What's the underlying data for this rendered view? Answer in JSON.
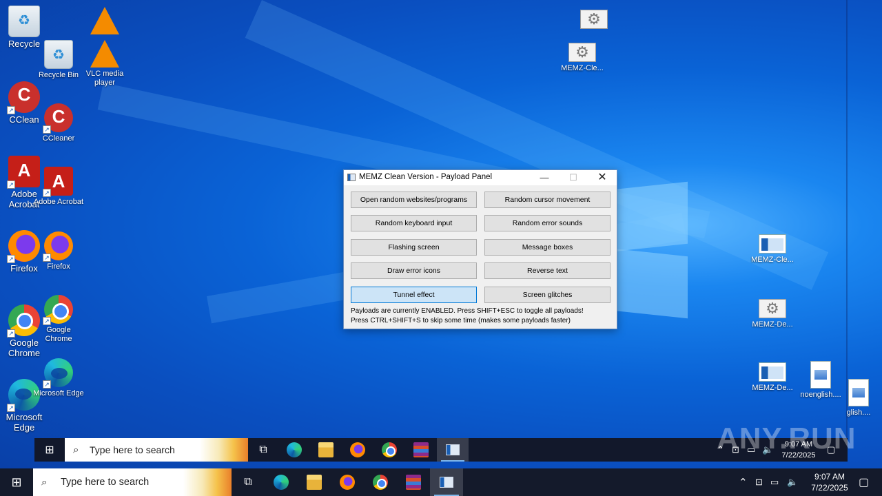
{
  "desktop_icons_outer": [
    {
      "id": "recycle",
      "label": "Recycle",
      "icon": "recycle-bin-icon"
    },
    {
      "id": "ccleaner",
      "label": "CClean",
      "icon": "ccleaner-icon"
    },
    {
      "id": "acrobat",
      "label": "Adobe Acrobat",
      "icon": "adobe-acrobat-icon"
    },
    {
      "id": "firefox",
      "label": "Firefox",
      "icon": "firefox-icon"
    },
    {
      "id": "chrome",
      "label": "Google Chrome",
      "icon": "chrome-icon"
    },
    {
      "id": "edge",
      "label": "Microsoft Edge",
      "icon": "edge-icon"
    }
  ],
  "desktop_icons_nested": [
    {
      "id": "recycle",
      "label": "Recycle Bin",
      "icon": "recycle-bin-icon"
    },
    {
      "id": "vlc",
      "label": "VLC media player",
      "icon": "vlc-icon"
    },
    {
      "id": "ccleaner",
      "label": "CCleaner",
      "icon": "ccleaner-icon"
    },
    {
      "id": "acrobat",
      "label": "Adobe Acrobat",
      "icon": "adobe-acrobat-icon"
    },
    {
      "id": "firefox",
      "label": "Firefox",
      "icon": "firefox-icon"
    },
    {
      "id": "chrome",
      "label": "Google Chrome",
      "icon": "chrome-icon"
    },
    {
      "id": "edge",
      "label": "Microsoft Edge",
      "icon": "edge-icon"
    },
    {
      "id": "memz1",
      "label": "MEMZ-Cle...",
      "icon": "settings-gear-icon"
    },
    {
      "id": "memz2",
      "label": "MEMZ-Cle...",
      "icon": "memz-app-icon"
    },
    {
      "id": "memz3",
      "label": "MEMZ-De...",
      "icon": "settings-gear-icon"
    },
    {
      "id": "memz4",
      "label": "MEMZ-De...",
      "icon": "memz-app-icon"
    },
    {
      "id": "noenglish",
      "label": "noenglish....",
      "icon": "document-image-icon"
    },
    {
      "id": "english",
      "label": "glish....",
      "icon": "document-image-icon"
    }
  ],
  "dialog": {
    "title": "MEMZ Clean Version - Payload Panel",
    "minimize": "—",
    "maximize": "☐",
    "close": "✕",
    "buttons": [
      {
        "label": "Open random websites/programs",
        "active": false
      },
      {
        "label": "Random cursor movement",
        "active": false
      },
      {
        "label": "Random keyboard input",
        "active": false
      },
      {
        "label": "Random error sounds",
        "active": false
      },
      {
        "label": "Flashing screen",
        "active": false
      },
      {
        "label": "Message boxes",
        "active": false
      },
      {
        "label": "Draw error icons",
        "active": false
      },
      {
        "label": "Reverse text",
        "active": false
      },
      {
        "label": "Tunnel effect",
        "active": true
      },
      {
        "label": "Screen glitches",
        "active": false
      }
    ],
    "status_line_1": "Payloads are currently ENABLED. Press SHIFT+ESC to toggle all payloads!",
    "status_line_2": "Press CTRL+SHIFT+S to skip some time (makes some payloads faster)"
  },
  "taskbar": {
    "search_placeholder": "Type here to search",
    "apps": [
      "task-view-icon",
      "edge-icon",
      "file-explorer-icon",
      "firefox-icon",
      "chrome-icon",
      "winrar-icon",
      "memz-app-icon"
    ],
    "active_app": "memz-app-icon",
    "time": "9:07 AM",
    "date": "7/22/2025"
  },
  "watermark": "ANY.RUN",
  "colors": {
    "accent": "#0078d7",
    "active_button": "#cce4f7",
    "taskbar": "#141a2b"
  }
}
